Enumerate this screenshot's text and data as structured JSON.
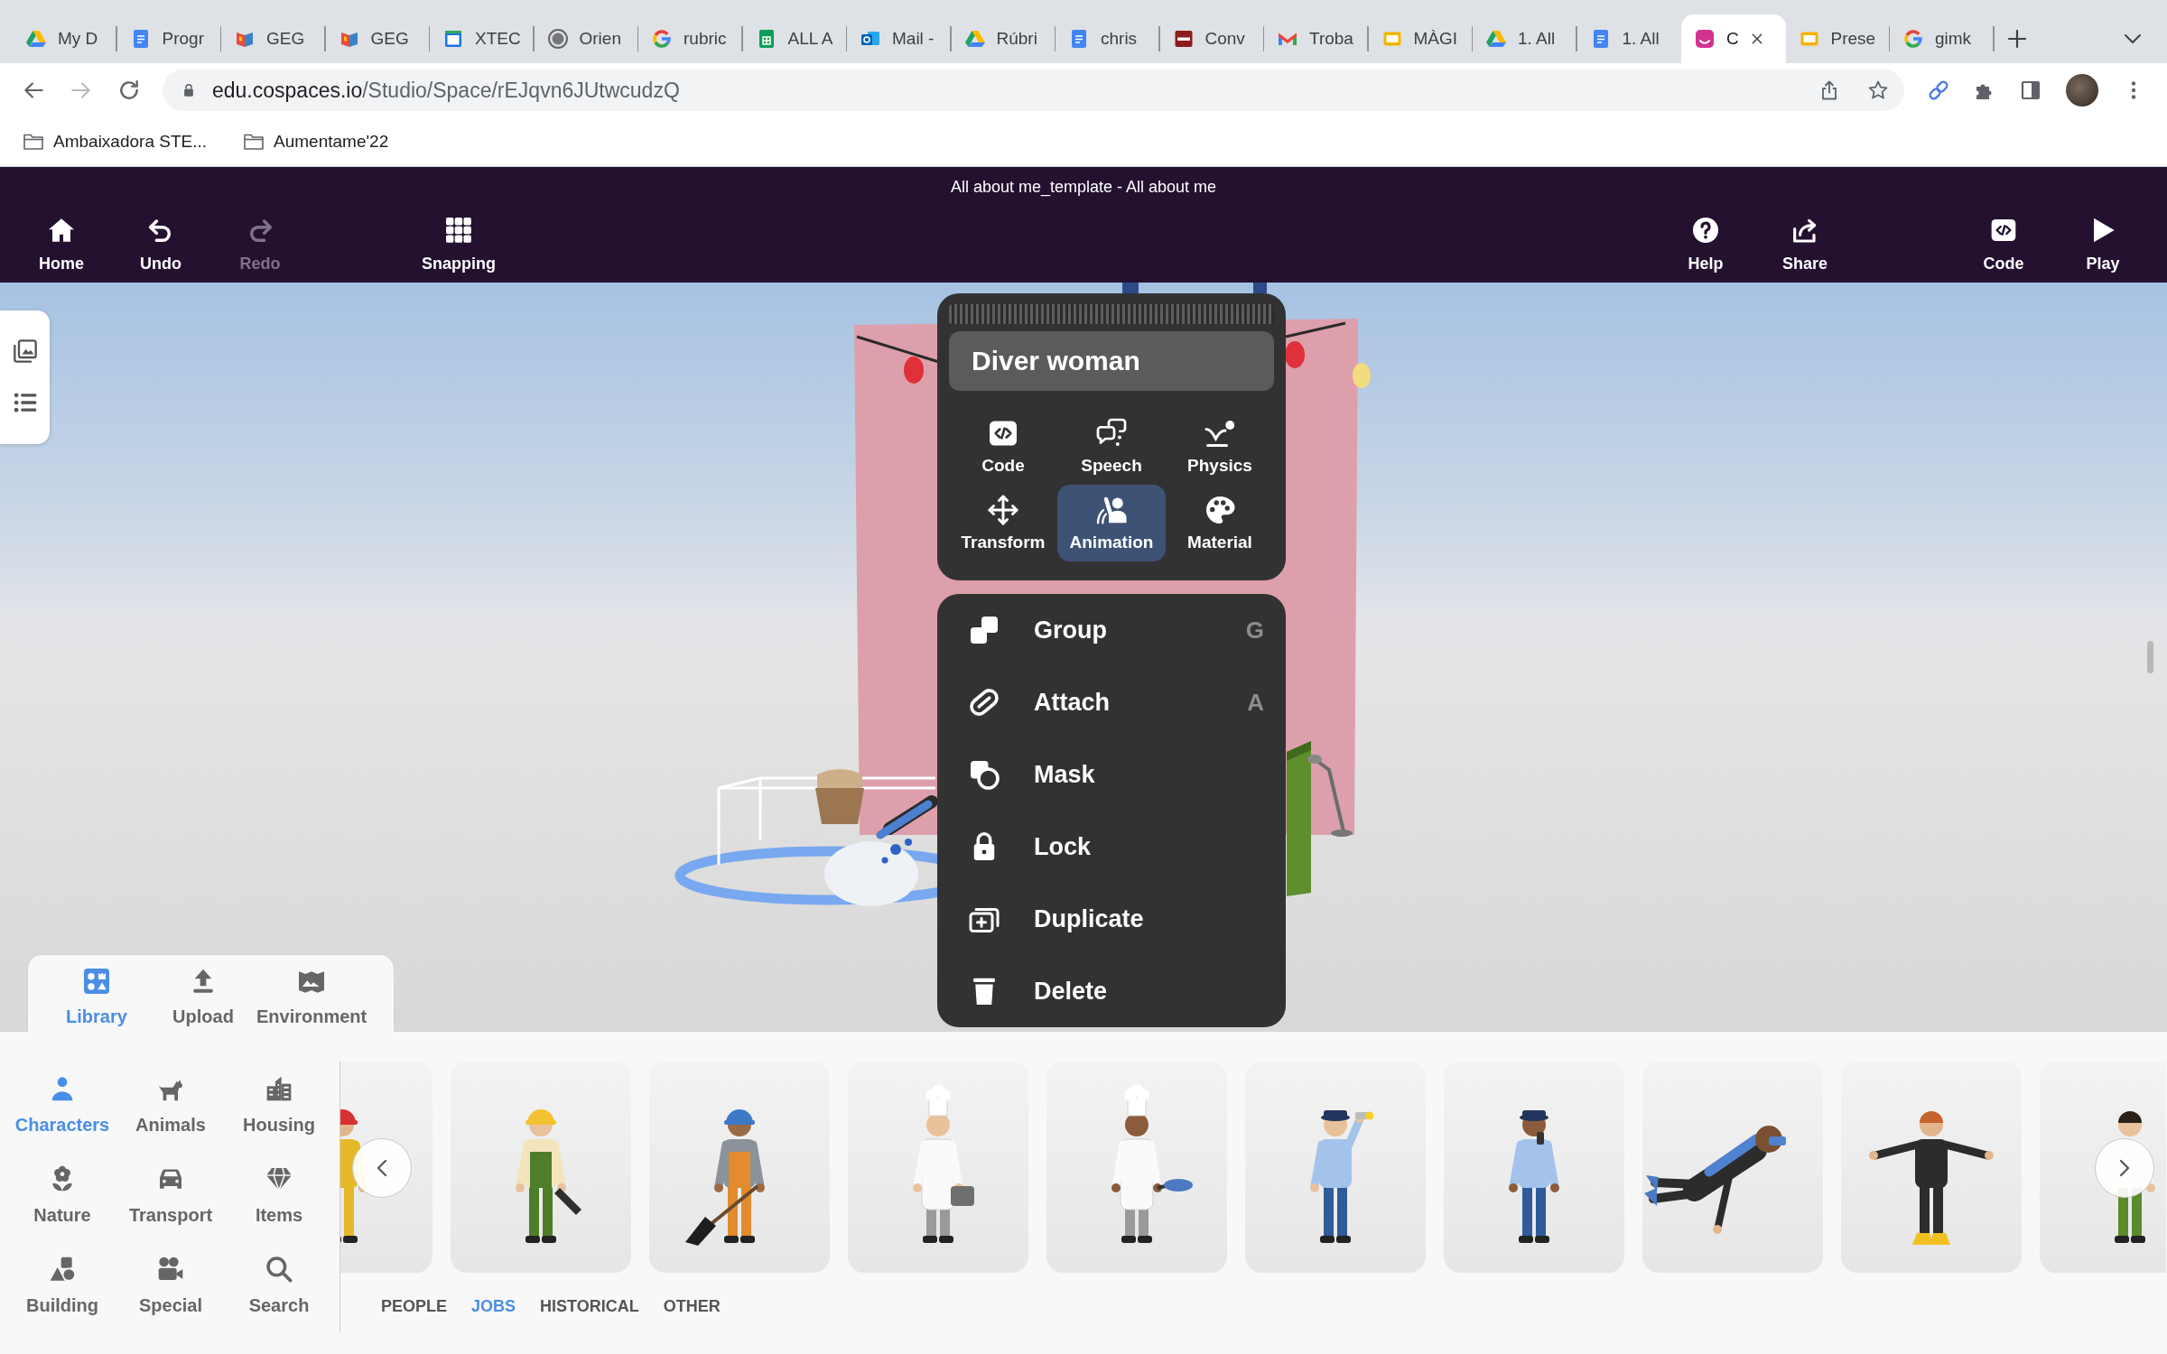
{
  "browser": {
    "tabs": [
      {
        "kind": "drive",
        "title": "My D",
        "selected": false
      },
      {
        "kind": "docs",
        "title": "Progr",
        "selected": false
      },
      {
        "kind": "geg",
        "title": "GEG",
        "selected": false
      },
      {
        "kind": "geg",
        "title": "GEG",
        "selected": false
      },
      {
        "kind": "xtec",
        "title": "XTEC",
        "selected": false
      },
      {
        "kind": "wordpress",
        "title": "Orien",
        "selected": false
      },
      {
        "kind": "google",
        "title": "rubric",
        "selected": false
      },
      {
        "kind": "sheets",
        "title": "ALL A",
        "selected": false
      },
      {
        "kind": "outlook",
        "title": "Mail -",
        "selected": false
      },
      {
        "kind": "drive",
        "title": "Rúbri",
        "selected": false
      },
      {
        "kind": "docs",
        "title": "chris",
        "selected": false
      },
      {
        "kind": "pdf",
        "title": "Conv",
        "selected": false
      },
      {
        "kind": "gmail",
        "title": "Troba",
        "selected": false
      },
      {
        "kind": "slides",
        "title": "MÀGI",
        "selected": false
      },
      {
        "kind": "drive",
        "title": "1. All",
        "selected": false
      },
      {
        "kind": "docs",
        "title": "1. All",
        "selected": false
      },
      {
        "kind": "cospaces",
        "title": "C",
        "selected": true
      },
      {
        "kind": "slides",
        "title": "Prese",
        "selected": false
      },
      {
        "kind": "google",
        "title": "gimk",
        "selected": false
      }
    ],
    "navigation": [
      {
        "kind": "back",
        "disabled": false
      },
      {
        "kind": "forward",
        "disabled": true
      },
      {
        "kind": "reload",
        "disabled": false
      }
    ],
    "address": {
      "host": "edu.cospaces.io",
      "path": "/Studio/Space/rEJqvn6JUtwcudzQ"
    },
    "bookmarks": [
      {
        "label": "Ambaixadora STE..."
      },
      {
        "label": "Aumentame'22"
      }
    ]
  },
  "toolbar": {
    "title": "All about me_template - All about me",
    "left_groups": [
      [
        {
          "kind": "home",
          "label": "Home",
          "disabled": false
        },
        {
          "kind": "undo",
          "label": "Undo",
          "disabled": false
        },
        {
          "kind": "redo",
          "label": "Redo",
          "disabled": true
        }
      ],
      [
        {
          "kind": "snapping",
          "label": "Snapping",
          "disabled": false
        }
      ]
    ],
    "right_groups": [
      [
        {
          "kind": "help",
          "label": "Help",
          "disabled": false
        },
        {
          "kind": "share",
          "label": "Share",
          "disabled": false
        }
      ],
      [
        {
          "kind": "code",
          "label": "Code",
          "disabled": false
        },
        {
          "kind": "play",
          "label": "Play",
          "disabled": false
        }
      ]
    ]
  },
  "object_menu": {
    "name": "Diver woman",
    "tools": [
      {
        "kind": "code",
        "label": "Code",
        "selected": false
      },
      {
        "kind": "speech",
        "label": "Speech",
        "selected": false
      },
      {
        "kind": "physics",
        "label": "Physics",
        "selected": false
      },
      {
        "kind": "transform",
        "label": "Transform",
        "selected": false
      },
      {
        "kind": "animation",
        "label": "Animation",
        "selected": true
      },
      {
        "kind": "material",
        "label": "Material",
        "selected": false
      }
    ],
    "actions": [
      {
        "kind": "group",
        "label": "Group",
        "shortcut": "G"
      },
      {
        "kind": "attach",
        "label": "Attach",
        "shortcut": "A"
      },
      {
        "kind": "mask",
        "label": "Mask"
      },
      {
        "kind": "lock",
        "label": "Lock"
      },
      {
        "kind": "duplicate",
        "label": "Duplicate"
      },
      {
        "kind": "delete",
        "label": "Delete"
      }
    ]
  },
  "library": {
    "tabs": [
      {
        "kind": "library",
        "label": "Library",
        "selected": true
      },
      {
        "kind": "upload",
        "label": "Upload",
        "selected": false
      },
      {
        "kind": "environment",
        "label": "Environment",
        "selected": false
      }
    ],
    "categories": [
      {
        "kind": "characters",
        "label": "Characters",
        "selected": true
      },
      {
        "kind": "animals",
        "label": "Animals",
        "selected": false
      },
      {
        "kind": "housing",
        "label": "Housing",
        "selected": false
      },
      {
        "kind": "nature",
        "label": "Nature",
        "selected": false
      },
      {
        "kind": "transport",
        "label": "Transport",
        "selected": false
      },
      {
        "kind": "items",
        "label": "Items",
        "selected": false
      },
      {
        "kind": "building",
        "label": "Building",
        "selected": false
      },
      {
        "kind": "special",
        "label": "Special",
        "selected": false
      },
      {
        "kind": "search",
        "label": "Search",
        "selected": false
      }
    ],
    "filters": [
      {
        "label": "PEOPLE",
        "selected": false
      },
      {
        "label": "JOBS",
        "selected": true
      },
      {
        "label": "HISTORICAL",
        "selected": false
      },
      {
        "label": "OTHER",
        "selected": false
      }
    ]
  }
}
